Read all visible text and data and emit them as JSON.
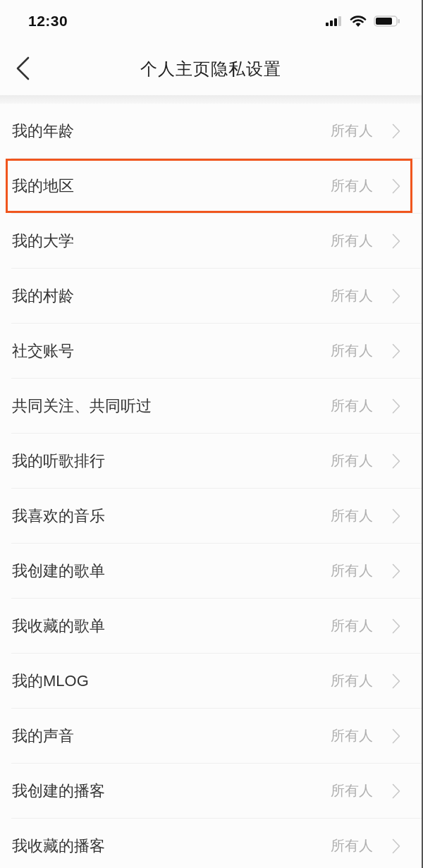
{
  "status_bar": {
    "time": "12:30"
  },
  "header": {
    "title": "个人主页隐私设置"
  },
  "rows": [
    {
      "label": "我的年龄",
      "value": "所有人",
      "highlighted": false
    },
    {
      "label": "我的地区",
      "value": "所有人",
      "highlighted": true
    },
    {
      "label": "我的大学",
      "value": "所有人",
      "highlighted": false
    },
    {
      "label": "我的村龄",
      "value": "所有人",
      "highlighted": false
    },
    {
      "label": "社交账号",
      "value": "所有人",
      "highlighted": false
    },
    {
      "label": "共同关注、共同听过",
      "value": "所有人",
      "highlighted": false
    },
    {
      "label": "我的听歌排行",
      "value": "所有人",
      "highlighted": false
    },
    {
      "label": "我喜欢的音乐",
      "value": "所有人",
      "highlighted": false
    },
    {
      "label": "我创建的歌单",
      "value": "所有人",
      "highlighted": false
    },
    {
      "label": "我收藏的歌单",
      "value": "所有人",
      "highlighted": false
    },
    {
      "label": "我的MLOG",
      "value": "所有人",
      "highlighted": false
    },
    {
      "label": "我的声音",
      "value": "所有人",
      "highlighted": false
    },
    {
      "label": "我创建的播客",
      "value": "所有人",
      "highlighted": false
    },
    {
      "label": "我收藏的播客",
      "value": "所有人",
      "highlighted": false
    }
  ]
}
